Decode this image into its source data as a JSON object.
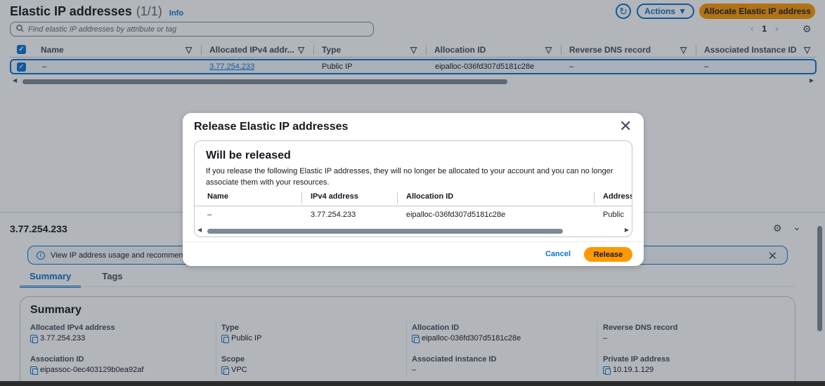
{
  "header": {
    "title": "Elastic IP addresses",
    "count": "(1/1)",
    "info": "Info",
    "actions_label": "Actions",
    "allocate_label": "Allocate Elastic IP address",
    "search_placeholder": "Find elastic IP addresses by attribute or tag",
    "page_number": "1"
  },
  "table": {
    "columns": [
      "Name",
      "Allocated IPv4 addr...",
      "Type",
      "Allocation ID",
      "Reverse DNS record",
      "Associated Instance ID"
    ],
    "row": {
      "name": "–",
      "ipv4": "3.77.254.233",
      "type": "Public IP",
      "allocation_id": "eipalloc-036fd307d5181c28e",
      "reverse_dns": "–",
      "instance_id": "–"
    }
  },
  "details": {
    "title": "3.77.254.233",
    "flash_text": "View IP address usage and recommen",
    "tabs": [
      "Summary",
      "Tags"
    ],
    "summary_title": "Summary",
    "fields": {
      "allocated_ipv4": {
        "label": "Allocated IPv4 address",
        "value": "3.77.254.233"
      },
      "type": {
        "label": "Type",
        "value": "Public IP"
      },
      "allocation_id": {
        "label": "Allocation ID",
        "value": "eipalloc-036fd307d5181c28e"
      },
      "reverse_dns": {
        "label": "Reverse DNS record",
        "value": "–"
      },
      "association_id": {
        "label": "Association ID",
        "value": "eipassoc-0ec403129b0ea92af"
      },
      "scope": {
        "label": "Scope",
        "value": "VPC"
      },
      "associated_instance": {
        "label": "Associated instance ID",
        "value": "–"
      },
      "private_ip": {
        "label": "Private IP address",
        "value": "10.19.1.129"
      }
    }
  },
  "modal": {
    "title": "Release Elastic IP addresses",
    "section_title": "Will be released",
    "description": "If you release the following Elastic IP addresses, they will no longer be allocated to your account and you can no longer associate them with your resources.",
    "columns": [
      "Name",
      "IPv4 address",
      "Allocation ID",
      "Address"
    ],
    "row": {
      "name": "–",
      "ipv4": "3.77.254.233",
      "allocation_id": "eipalloc-036fd307d5181c28e",
      "address_type": "Public"
    },
    "cancel_label": "Cancel",
    "release_label": "Release"
  }
}
